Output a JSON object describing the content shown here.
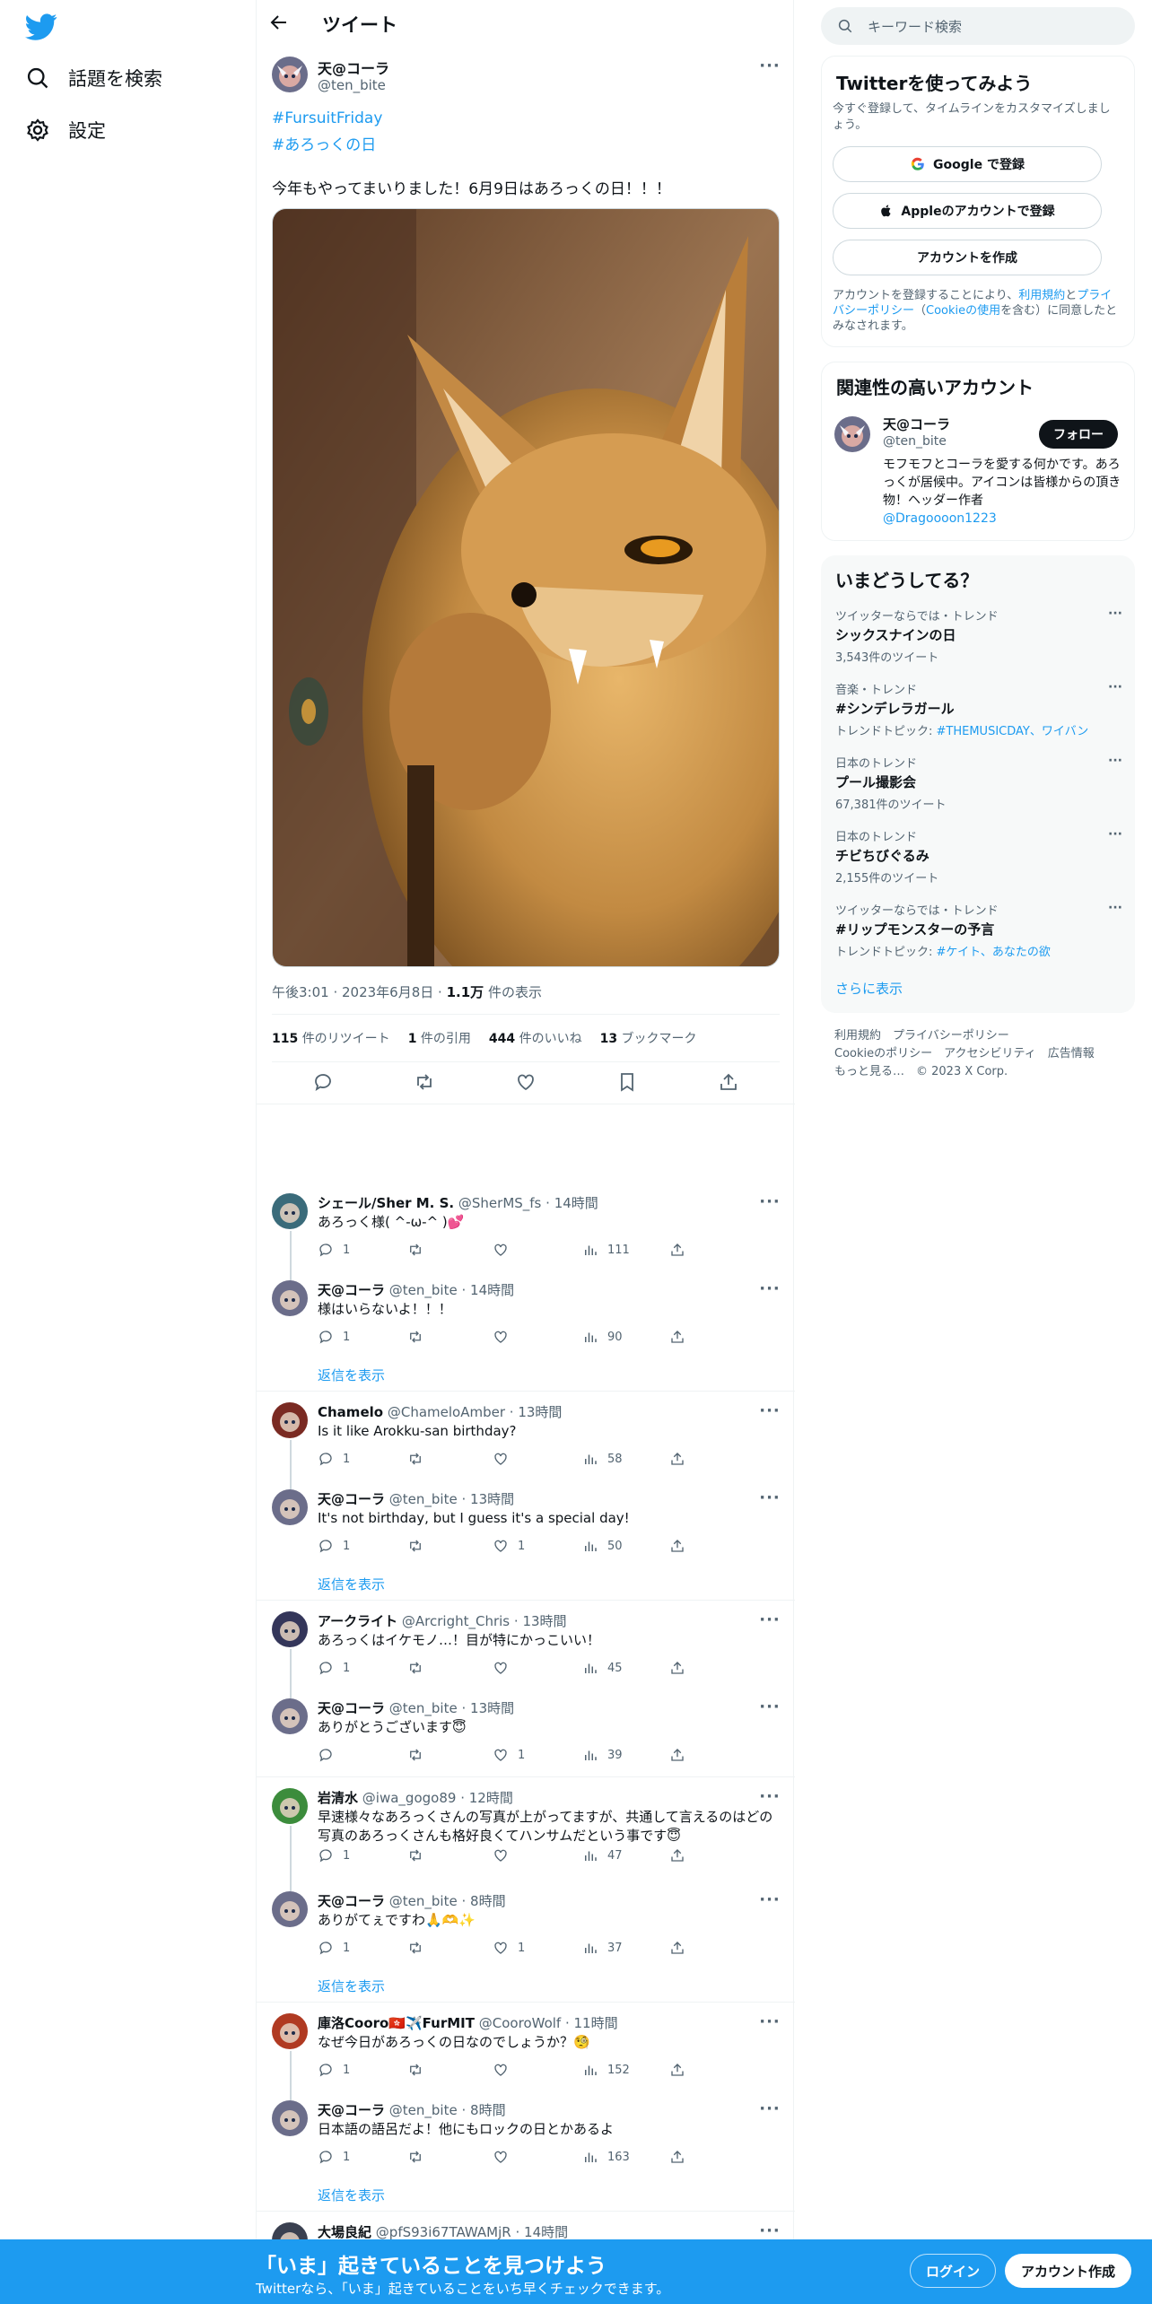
{
  "nav": {
    "search_label": "話題を検索",
    "settings_label": "設定"
  },
  "header": {
    "title": "ツイート"
  },
  "tweet": {
    "name": "天@コーラ",
    "handle": "@ten_bite",
    "hashtags": [
      "#FursuitFriday",
      "#あろっくの日"
    ],
    "text": "今年もやってまいりました！6月9日はあろっくの日！！！",
    "time": "午後3:01",
    "date": "2023年6月8日",
    "views_count": "1.1万",
    "views_label": "件の表示",
    "retweets": "115",
    "retweets_label": "件のリツイート",
    "quotes": "1",
    "quotes_label": "件の引用",
    "likes": "444",
    "likes_label": "件のいいね",
    "bookmarks": "13",
    "bookmarks_label": "ブックマーク"
  },
  "replies_show_label": "返信を表示",
  "replies": [
    {
      "name": "シェール/Sher M. S.",
      "handle": "@SherMS_fs",
      "time": "14時間",
      "text": "あろっく様( ^-ω-^ )💕",
      "replies": "1",
      "likes": "",
      "views": "111"
    },
    {
      "name": "天@コーラ",
      "handle": "@ten_bite",
      "time": "14時間",
      "text": "様はいらないよ！！！",
      "replies": "1",
      "likes": "",
      "views": "90"
    },
    {
      "name": "Chamelo",
      "handle": "@ChameloAmber",
      "time": "13時間",
      "text": "Is it like Arokku-san birthday?",
      "replies": "1",
      "likes": "",
      "views": "58"
    },
    {
      "name": "天@コーラ",
      "handle": "@ten_bite",
      "time": "13時間",
      "text": "It's not birthday, but I guess it's a special day!",
      "replies": "1",
      "likes": "1",
      "views": "50"
    },
    {
      "name": "アークライト",
      "handle": "@Arcright_Chris",
      "time": "13時間",
      "text": "あろっくはイケモノ…！目が特にかっこいい！",
      "replies": "1",
      "likes": "",
      "views": "45"
    },
    {
      "name": "天@コーラ",
      "handle": "@ten_bite",
      "time": "13時間",
      "text": "ありがとうございます😇",
      "replies": "",
      "likes": "1",
      "views": "39"
    },
    {
      "name": "岩清水",
      "handle": "@iwa_gogo89",
      "time": "12時間",
      "text": "早速様々なあろっくさんの写真が上がってますが、共通して言えるのはどの写真のあろっくさんも格好良くてハンサムだという事です😇",
      "replies": "1",
      "likes": "",
      "views": "47"
    },
    {
      "name": "天@コーラ",
      "handle": "@ten_bite",
      "time": "8時間",
      "text": "ありがてぇですわ🙏🫶✨",
      "replies": "1",
      "likes": "1",
      "views": "37"
    },
    {
      "name": "庫洛Cooro🇭🇰✈️FurMIT",
      "handle": "@CooroWolf",
      "time": "11時間",
      "text": "なぜ今日があろっくの日なのでしょうか？🧐",
      "replies": "1",
      "likes": "",
      "views": "152"
    },
    {
      "name": "天@コーラ",
      "handle": "@ten_bite",
      "time": "8時間",
      "text": "日本語の語呂だよ！他にもロックの日とかあるよ",
      "replies": "1",
      "likes": "",
      "views": "163"
    },
    {
      "name": "大場良紀",
      "handle": "@pfS93i67TAWAMjR",
      "time": "14時間",
      "text": "",
      "replies": "",
      "likes": "",
      "views": ""
    }
  ],
  "sidebar": {
    "search_placeholder": "キーワード検索",
    "signup": {
      "title": "Twitterを使ってみよう",
      "desc": "今すぐ登録して、タイムラインをカスタマイズしましょう。",
      "google": "Google で登録",
      "apple": "Appleのアカウントで登録",
      "create": "アカウントを作成",
      "legal_1": "アカウントを登録することにより、",
      "legal_terms": "利用規約",
      "legal_2": "と",
      "legal_privacy": "プライバシーポリシー",
      "legal_3": "（",
      "legal_cookie": "Cookieの使用",
      "legal_4": "を含む）に同意したとみなされます。"
    },
    "related": {
      "title": "関連性の高いアカウント",
      "name": "天@コーラ",
      "handle": "@ten_bite",
      "follow": "フォロー",
      "bio": "モフモフとコーラを愛する何かです。あろっくが居候中。アイコンは皆様からの頂き物！ヘッダー作者",
      "bio_link": "@Dragoooon1223"
    },
    "trends": {
      "title": "いまどうしてる？",
      "items": [
        {
          "meta": "ツイッターならでは・トレンド",
          "name": "シックスナインの日",
          "sub": "3,543件のツイート"
        },
        {
          "meta": "音楽・トレンド",
          "name": "#シンデレラガール",
          "sub_prefix": "トレンドトピック: ",
          "sub_link": "#THEMUSICDAY、ワイバン"
        },
        {
          "meta": "日本のトレンド",
          "name": "プール撮影会",
          "sub": "67,381件のツイート"
        },
        {
          "meta": "日本のトレンド",
          "name": "チビちびぐるみ",
          "sub": "2,155件のツイート"
        },
        {
          "meta": "ツイッターならでは・トレンド",
          "name": "#リップモンスターの予言",
          "sub_prefix": "トレンドトピック: ",
          "sub_link": "#ケイト、あなたの欲"
        }
      ],
      "more": "さらに表示"
    },
    "footer": {
      "l1": "利用規約　プライバシーポリシー",
      "l2": "Cookieのポリシー　アクセシビリティ　広告情報",
      "l3": "もっと見る…　© 2023 X Corp."
    }
  },
  "bottom": {
    "headline": "「いま」起きていることを見つけよう",
    "sub": "Twitterなら、「いま」起きていることをいち早くチェックできます。",
    "login": "ログイン",
    "signup": "アカウント作成"
  },
  "colors": {
    "accent": "#1d9bf0",
    "text": "#0f1419",
    "muted": "#536471"
  }
}
